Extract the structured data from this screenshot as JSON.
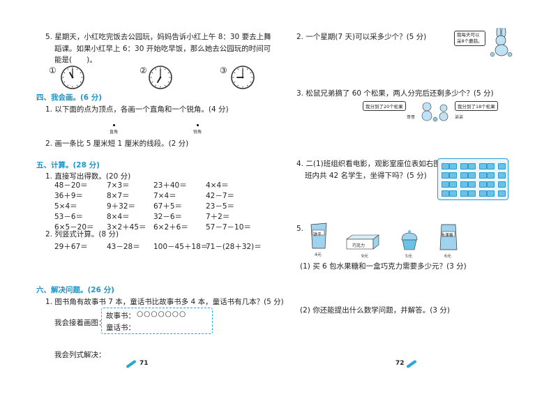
{
  "left": {
    "q5_line1": "5. 星期天，小红吃完饭去公园玩，妈妈告诉小红上午 8：30 要去上舞",
    "q5_line2": "蹈课。如果小红早上 6：30 开始吃早饭，那么她去公园玩的时间可",
    "q5_line3": "能是(　　)。",
    "clock_labels": [
      "①",
      "②",
      "③"
    ],
    "clock_times": [
      {
        "hour": 11,
        "minute": 0
      },
      {
        "hour": 7,
        "minute": 0
      },
      {
        "hour": 9,
        "minute": 0
      }
    ],
    "sec4_title": "四、我会画。(6 分)",
    "sec4_q1": "1. 以下面的点为顶点，各画一个直角和一个锐角。(4 分)",
    "dot_label_right": "直角",
    "dot_label_acute": "锐角",
    "sec4_q2": "2. 画一条比 5 厘米短 1 厘米的线段。(2 分)",
    "sec5_title": "五、计算。(28 分)",
    "sec5_q1": "1. 直接写出得数。(20 分)",
    "calc_rows": [
      [
        "48－20＝",
        "7×3＝",
        "23＋40＝",
        "4×4＝"
      ],
      [
        "36＋9＝",
        "8×7＝",
        "7×4＝",
        "42－7＝"
      ],
      [
        "5×4＝",
        "9＋32＝",
        "67＋5＝",
        "23－5＝"
      ],
      [
        "53－6＝",
        "8×4＝",
        "32－6＝",
        "7＋2＝"
      ],
      [
        "6×5－20＝",
        "3×2＋45＝",
        "6×2＋6＝",
        "57－7－10＝"
      ]
    ],
    "sec5_q2": "2. 列竖式计算。(8 分)",
    "vertical_calc": [
      "29＋67＝",
      "43－28＝",
      "100－45＋18＝",
      "71－(28＋32)＝"
    ],
    "sec6_title": "六、解决问题。(26 分)",
    "sec6_q1": "1. 图书角有故事书 7 本，童话书比故事书多 4 本，童话书有几本？(5 分)",
    "draw_label": "我会接着画图：",
    "story_label": "故事书：",
    "story_circles": "○○○○○○○",
    "fairy_label": "童话书：",
    "solve_label": "我会列式解决：",
    "page_number": "71"
  },
  "right": {
    "q2": "2. 一个星期(7 天)可以采多少个？(5 分)",
    "q2_bubble_l1": "我每天可以",
    "q2_bubble_l2": "采8个蘑菇。",
    "q3": "3. 松鼠兄弟摘了 60 个松果，两人分完后还剩多少个？(5 分)",
    "q3_bubble_left": "我分到了20个松果",
    "q3_bubble_right": "我分到了18个松果",
    "q3_brother_old": "哥哥",
    "q3_brother_young": "弟弟",
    "q4_line1": "4. 二(1)班组织看电影，观影室座位表如右图。",
    "q4_line2": "班内共 42 名学生，坐得下吗？(5 分)",
    "q5_num": "5.",
    "item_labels": [
      "饼干",
      "巧克力",
      "",
      "水果糖"
    ],
    "item_prices": [
      "4元",
      "9元",
      "5元",
      "6元"
    ],
    "q5_1": "(1) 买 6 包水果糖和一盒巧克力需要多少元？(3 分)",
    "q5_2": "(2) 你还能提出什么数学问题，并解答。(3 分)",
    "page_number": "72"
  }
}
